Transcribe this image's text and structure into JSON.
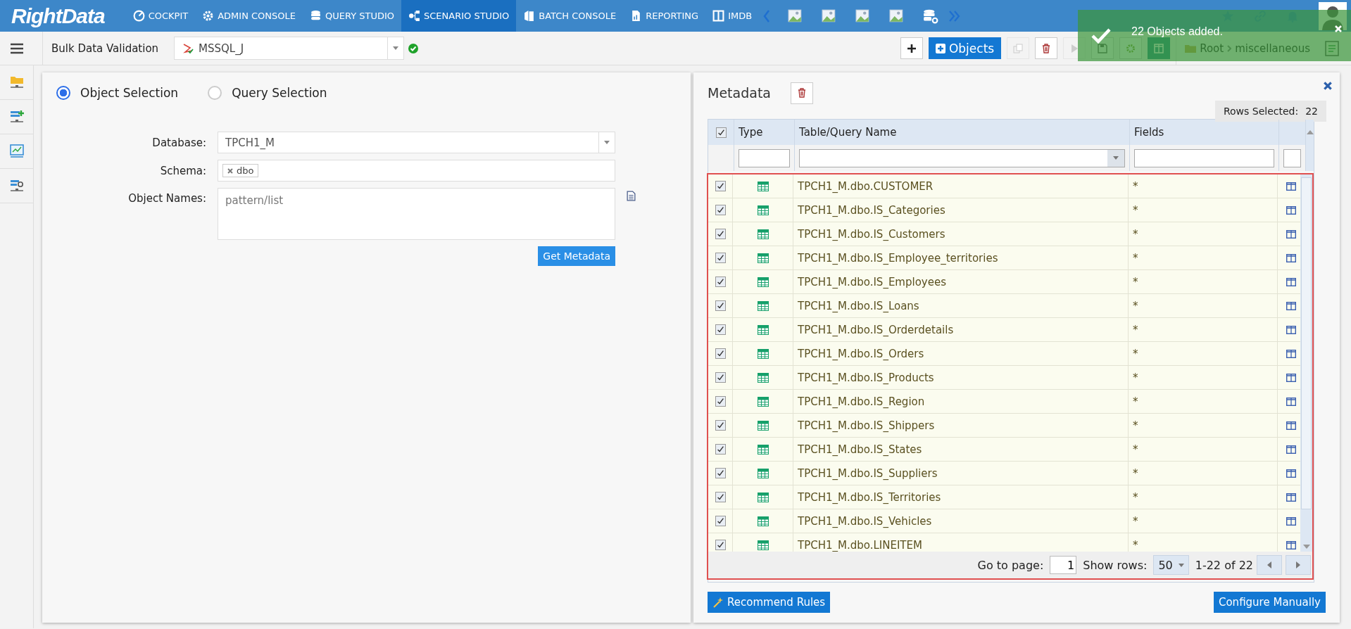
{
  "nav": {
    "logo": "RightData",
    "items": [
      {
        "label": "COCKPIT",
        "selected": false
      },
      {
        "label": "ADMIN CONSOLE",
        "selected": false
      },
      {
        "label": "QUERY STUDIO",
        "selected": false
      },
      {
        "label": "SCENARIO STUDIO",
        "selected": true
      },
      {
        "label": "BATCH CONSOLE",
        "selected": false
      },
      {
        "label": "REPORTING",
        "selected": false
      },
      {
        "label": "IMDB",
        "selected": false
      }
    ]
  },
  "toolbar": {
    "title": "Bulk Data Validation",
    "connection": "MSSQL_J",
    "connected": true,
    "objects_button": "Objects",
    "breadcrumb": [
      "Root",
      "miscellaneous"
    ]
  },
  "toast": {
    "message": "22 Objects added."
  },
  "selection": {
    "modes": [
      {
        "label": "Object Selection",
        "selected": true
      },
      {
        "label": "Query Selection",
        "selected": false
      }
    ],
    "database_label": "Database:",
    "database": "TPCH1_M",
    "schema_label": "Schema:",
    "schema_tags": [
      "dbo"
    ],
    "object_names_label": "Object Names:",
    "object_names_placeholder": "pattern/list",
    "get_button": "Get Metadata"
  },
  "metadata": {
    "title": "Metadata",
    "rows_selected_label": "Rows Selected:",
    "rows_selected": "22",
    "columns": [
      "Type",
      "Table/Query Name",
      "Fields"
    ],
    "header_checked": true,
    "rows": [
      {
        "name": "TPCH1_M.dbo.CUSTOMER",
        "fields": "*",
        "checked": true
      },
      {
        "name": "TPCH1_M.dbo.IS_Categories",
        "fields": "*",
        "checked": true
      },
      {
        "name": "TPCH1_M.dbo.IS_Customers",
        "fields": "*",
        "checked": true
      },
      {
        "name": "TPCH1_M.dbo.IS_Employee_territories",
        "fields": "*",
        "checked": true
      },
      {
        "name": "TPCH1_M.dbo.IS_Employees",
        "fields": "*",
        "checked": true
      },
      {
        "name": "TPCH1_M.dbo.IS_Loans",
        "fields": "*",
        "checked": true
      },
      {
        "name": "TPCH1_M.dbo.IS_Orderdetails",
        "fields": "*",
        "checked": true
      },
      {
        "name": "TPCH1_M.dbo.IS_Orders",
        "fields": "*",
        "checked": true
      },
      {
        "name": "TPCH1_M.dbo.IS_Products",
        "fields": "*",
        "checked": true
      },
      {
        "name": "TPCH1_M.dbo.IS_Region",
        "fields": "*",
        "checked": true
      },
      {
        "name": "TPCH1_M.dbo.IS_Shippers",
        "fields": "*",
        "checked": true
      },
      {
        "name": "TPCH1_M.dbo.IS_States",
        "fields": "*",
        "checked": true
      },
      {
        "name": "TPCH1_M.dbo.IS_Suppliers",
        "fields": "*",
        "checked": true
      },
      {
        "name": "TPCH1_M.dbo.IS_Territories",
        "fields": "*",
        "checked": true
      },
      {
        "name": "TPCH1_M.dbo.IS_Vehicles",
        "fields": "*",
        "checked": true
      },
      {
        "name": "TPCH1_M.dbo.LINEITEM",
        "fields": "*",
        "checked": true
      }
    ],
    "pager": {
      "goto_label": "Go to page:",
      "page": "1",
      "show_rows_label": "Show rows:",
      "show_rows": "50",
      "range": "1-22 of 22"
    },
    "recommend_button": "Recommend Rules",
    "configure_button": "Configure Manually"
  }
}
